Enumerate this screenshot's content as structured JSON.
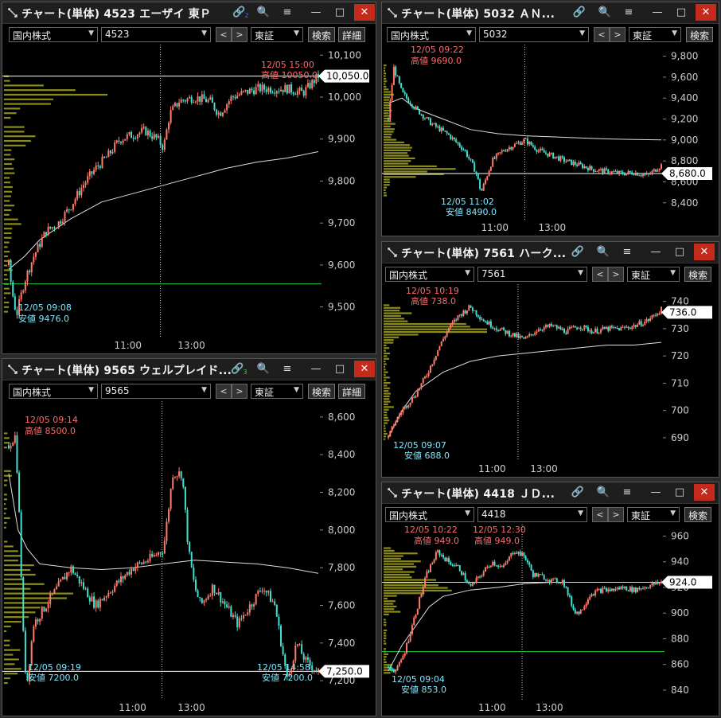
{
  "market_options": "国内株式",
  "exchange": "東証",
  "search_label": "検索",
  "detail_label": "詳細",
  "colors": {
    "up": "#ff7b6b",
    "down": "#40e0d0",
    "vwap": "#dddddd",
    "volume": "#8b8b1a",
    "support": "#22cc44",
    "high": "#ff6a6a",
    "low": "#7fe6ff"
  },
  "windows": [
    {
      "id": "w1",
      "title": "チャート(単体) 4523 エーザイ 東Ｐ",
      "code": "4523",
      "link_badge": "2",
      "has_detail": true,
      "high_time": "12/05 15:00",
      "high_label": "高値 10050.0",
      "low_time": "12/05 09:08",
      "low_label": "安値 9476.0",
      "current_price": "10,050.0",
      "x_ticks": [
        "11:00",
        "13:00"
      ],
      "y_ticks": [
        "10,100",
        "10,000",
        "9,900",
        "9,800",
        "9,700",
        "9,600",
        "9,500"
      ]
    },
    {
      "id": "w2",
      "title": "チャート(単体) 5032 ＡＮ...",
      "code": "5032",
      "link_badge": "",
      "has_detail": false,
      "high_time": "12/05 09:22",
      "high_label": "高値 9690.0",
      "low_time": "12/05 11:02",
      "low_label": "安値 8490.0",
      "current_price": "8,680.0",
      "x_ticks": [
        "11:00",
        "13:00"
      ],
      "y_ticks": [
        "9,800",
        "9,600",
        "9,400",
        "9,200",
        "9,000",
        "8,800",
        "8,600",
        "8,400"
      ]
    },
    {
      "id": "w3",
      "title": "チャート(単体) 9565 ウェルプレイド...",
      "code": "9565",
      "link_badge": "3",
      "has_detail": true,
      "high_time": "12/05 09:14",
      "high_label": "高値 8500.0",
      "low_time": "12/05 09:19",
      "low_label": "安値 7200.0",
      "low2_time": "12/05 14:58",
      "low2_label": "安値 7200.0",
      "current_price": "7,250.0",
      "x_ticks": [
        "11:00",
        "13:00"
      ],
      "y_ticks": [
        "8,600",
        "8,400",
        "8,200",
        "8,000",
        "7,800",
        "7,600",
        "7,400",
        "7,200"
      ]
    },
    {
      "id": "w4",
      "title": "チャート(単体) 7561 ハーク...",
      "code": "7561",
      "link_badge": "",
      "has_detail": false,
      "high_time": "12/05 10:19",
      "high_label": "高値 738.0",
      "low_time": "12/05 09:07",
      "low_label": "安値 688.0",
      "current_price": "736.0",
      "x_ticks": [
        "11:00",
        "13:00"
      ],
      "y_ticks": [
        "740",
        "730",
        "720",
        "710",
        "700",
        "690"
      ]
    },
    {
      "id": "w5",
      "title": "チャート(単体) 4418 ＪＤ...",
      "code": "4418",
      "link_badge": "",
      "has_detail": false,
      "high_time": "12/05 10:22",
      "high_label": "高値 949.0",
      "high2_time": "12/05 12:30",
      "high2_label": "高値 949.0",
      "low_time": "12/05 09:04",
      "low_label": "安値 853.0",
      "current_price": "924.0",
      "x_ticks": [
        "11:00",
        "13:00"
      ],
      "y_ticks": [
        "960",
        "940",
        "920",
        "900",
        "880",
        "860",
        "840"
      ]
    }
  ],
  "chart_data": [
    {
      "type": "candlestick",
      "title": "4523",
      "ylim": [
        9450,
        10110
      ],
      "path": [
        [
          0,
          9600
        ],
        [
          0.01,
          9540
        ],
        [
          0.025,
          9480
        ],
        [
          0.05,
          9560
        ],
        [
          0.08,
          9620
        ],
        [
          0.12,
          9680
        ],
        [
          0.16,
          9700
        ],
        [
          0.2,
          9740
        ],
        [
          0.24,
          9790
        ],
        [
          0.28,
          9830
        ],
        [
          0.32,
          9860
        ],
        [
          0.36,
          9900
        ],
        [
          0.4,
          9910
        ],
        [
          0.44,
          9920
        ],
        [
          0.48,
          9900
        ],
        [
          0.5,
          9880
        ],
        [
          0.52,
          9960
        ],
        [
          0.55,
          9990
        ],
        [
          0.6,
          10000
        ],
        [
          0.65,
          9990
        ],
        [
          0.68,
          9960
        ],
        [
          0.72,
          10000
        ],
        [
          0.76,
          10010
        ],
        [
          0.8,
          10020
        ],
        [
          0.85,
          10020
        ],
        [
          0.9,
          10020
        ],
        [
          0.95,
          10010
        ],
        [
          1,
          10050
        ]
      ],
      "vwap": [
        [
          0,
          9590
        ],
        [
          0.05,
          9620
        ],
        [
          0.1,
          9660
        ],
        [
          0.2,
          9710
        ],
        [
          0.3,
          9750
        ],
        [
          0.4,
          9770
        ],
        [
          0.5,
          9790
        ],
        [
          0.6,
          9810
        ],
        [
          0.7,
          9830
        ],
        [
          0.8,
          9845
        ],
        [
          0.9,
          9855
        ],
        [
          1,
          9870
        ]
      ],
      "hlines": [
        {
          "y": 10050,
          "color": "#ffffff"
        },
        {
          "y": 9555,
          "color": "#22cc44"
        }
      ],
      "x_ticks": [
        {
          "label": "11:00",
          "x": 0.385
        },
        {
          "label": "13:00",
          "x": 0.59
        }
      ],
      "break_x": 0.49,
      "y_ticks": [
        10100,
        10000,
        9900,
        9800,
        9700,
        9600,
        9500
      ],
      "current": 10050,
      "vol_profile_top": 9860,
      "vol_profile_bottom": 9990
    },
    {
      "type": "candlestick",
      "title": "5032",
      "ylim": [
        8330,
        9850
      ],
      "path": [
        [
          0,
          9200
        ],
        [
          0.02,
          9690
        ],
        [
          0.05,
          9450
        ],
        [
          0.1,
          9300
        ],
        [
          0.16,
          9150
        ],
        [
          0.22,
          9050
        ],
        [
          0.28,
          8900
        ],
        [
          0.32,
          8700
        ],
        [
          0.34,
          8500
        ],
        [
          0.38,
          8800
        ],
        [
          0.42,
          8900
        ],
        [
          0.46,
          8950
        ],
        [
          0.5,
          9000
        ],
        [
          0.55,
          8900
        ],
        [
          0.6,
          8850
        ],
        [
          0.65,
          8800
        ],
        [
          0.7,
          8760
        ],
        [
          0.75,
          8720
        ],
        [
          0.8,
          8700
        ],
        [
          0.85,
          8680
        ],
        [
          0.9,
          8690
        ],
        [
          0.95,
          8660
        ],
        [
          1,
          8760
        ]
      ],
      "vwap": [
        [
          0,
          9350
        ],
        [
          0.05,
          9400
        ],
        [
          0.1,
          9300
        ],
        [
          0.2,
          9200
        ],
        [
          0.3,
          9100
        ],
        [
          0.4,
          9060
        ],
        [
          0.5,
          9040
        ],
        [
          0.6,
          9030
        ],
        [
          0.7,
          9020
        ],
        [
          0.8,
          9010
        ],
        [
          0.9,
          9005
        ],
        [
          1,
          9000
        ]
      ],
      "hlines": [
        {
          "y": 8680,
          "color": "#ffffff"
        }
      ],
      "x_ticks": [
        {
          "label": "11:00",
          "x": 0.39
        },
        {
          "label": "13:00",
          "x": 0.6
        }
      ],
      "break_x": 0.5,
      "y_ticks": [
        9800,
        9600,
        9400,
        9200,
        9000,
        8800,
        8600,
        8400
      ],
      "current": 8680
    },
    {
      "type": "candlestick",
      "title": "9565",
      "ylim": [
        7150,
        8650
      ],
      "path": [
        [
          0,
          8450
        ],
        [
          0.02,
          8500
        ],
        [
          0.03,
          8250
        ],
        [
          0.05,
          7300
        ],
        [
          0.06,
          7200
        ],
        [
          0.08,
          7500
        ],
        [
          0.12,
          7600
        ],
        [
          0.16,
          7700
        ],
        [
          0.2,
          7800
        ],
        [
          0.24,
          7700
        ],
        [
          0.28,
          7600
        ],
        [
          0.34,
          7700
        ],
        [
          0.4,
          7800
        ],
        [
          0.46,
          7850
        ],
        [
          0.5,
          7900
        ],
        [
          0.53,
          8300
        ],
        [
          0.56,
          8300
        ],
        [
          0.58,
          7900
        ],
        [
          0.6,
          7700
        ],
        [
          0.62,
          7600
        ],
        [
          0.66,
          7700
        ],
        [
          0.7,
          7600
        ],
        [
          0.74,
          7500
        ],
        [
          0.78,
          7600
        ],
        [
          0.82,
          7700
        ],
        [
          0.86,
          7600
        ],
        [
          0.88,
          7400
        ],
        [
          0.9,
          7200
        ],
        [
          0.93,
          7400
        ],
        [
          0.96,
          7300
        ],
        [
          1,
          7250
        ]
      ],
      "vwap": [
        [
          0,
          8300
        ],
        [
          0.03,
          8000
        ],
        [
          0.06,
          7900
        ],
        [
          0.1,
          7820
        ],
        [
          0.2,
          7800
        ],
        [
          0.3,
          7790
        ],
        [
          0.4,
          7800
        ],
        [
          0.5,
          7820
        ],
        [
          0.6,
          7840
        ],
        [
          0.7,
          7830
        ],
        [
          0.8,
          7820
        ],
        [
          0.9,
          7800
        ],
        [
          1,
          7770
        ]
      ],
      "hlines": [
        {
          "y": 7250,
          "color": "#ffffff"
        }
      ],
      "x_ticks": [
        {
          "label": "11:00",
          "x": 0.4
        },
        {
          "label": "13:00",
          "x": 0.59
        }
      ],
      "break_x": 0.495,
      "y_ticks": [
        8600,
        8400,
        8200,
        8000,
        7800,
        7600,
        7400,
        7200
      ],
      "current": 7250
    },
    {
      "type": "candlestick",
      "title": "7561",
      "ylim": [
        685,
        744
      ],
      "path": [
        [
          0,
          690
        ],
        [
          0.02,
          695
        ],
        [
          0.05,
          700
        ],
        [
          0.1,
          706
        ],
        [
          0.14,
          713
        ],
        [
          0.18,
          722
        ],
        [
          0.22,
          730
        ],
        [
          0.26,
          735
        ],
        [
          0.3,
          738
        ],
        [
          0.35,
          733
        ],
        [
          0.4,
          730
        ],
        [
          0.45,
          728
        ],
        [
          0.5,
          726
        ],
        [
          0.55,
          730
        ],
        [
          0.6,
          731
        ],
        [
          0.65,
          729
        ],
        [
          0.7,
          731
        ],
        [
          0.75,
          729
        ],
        [
          0.8,
          730
        ],
        [
          0.85,
          730
        ],
        [
          0.9,
          731
        ],
        [
          0.95,
          733
        ],
        [
          1,
          737
        ]
      ],
      "vwap": [
        [
          0,
          690
        ],
        [
          0.05,
          700
        ],
        [
          0.1,
          707
        ],
        [
          0.2,
          714
        ],
        [
          0.3,
          718
        ],
        [
          0.4,
          720
        ],
        [
          0.5,
          721
        ],
        [
          0.6,
          722
        ],
        [
          0.7,
          723
        ],
        [
          0.8,
          724
        ],
        [
          0.9,
          724
        ],
        [
          1,
          725
        ]
      ],
      "hlines": [],
      "x_ticks": [
        {
          "label": "11:00",
          "x": 0.38
        },
        {
          "label": "13:00",
          "x": 0.57
        }
      ],
      "break_x": 0.475,
      "y_ticks": [
        740,
        730,
        720,
        710,
        700,
        690
      ],
      "current": 736
    },
    {
      "type": "candlestick",
      "title": "4418",
      "ylim": [
        840,
        964
      ],
      "path": [
        [
          0,
          858
        ],
        [
          0.03,
          855
        ],
        [
          0.06,
          870
        ],
        [
          0.1,
          900
        ],
        [
          0.14,
          930
        ],
        [
          0.18,
          948
        ],
        [
          0.22,
          940
        ],
        [
          0.26,
          935
        ],
        [
          0.3,
          920
        ],
        [
          0.34,
          930
        ],
        [
          0.38,
          940
        ],
        [
          0.42,
          935
        ],
        [
          0.46,
          949
        ],
        [
          0.5,
          944
        ],
        [
          0.53,
          930
        ],
        [
          0.57,
          928
        ],
        [
          0.6,
          925
        ],
        [
          0.64,
          925
        ],
        [
          0.68,
          902
        ],
        [
          0.7,
          900
        ],
        [
          0.74,
          915
        ],
        [
          0.78,
          918
        ],
        [
          0.82,
          918
        ],
        [
          0.86,
          920
        ],
        [
          0.9,
          918
        ],
        [
          0.95,
          921
        ],
        [
          1,
          924
        ]
      ],
      "vwap": [
        [
          0,
          855
        ],
        [
          0.05,
          875
        ],
        [
          0.1,
          890
        ],
        [
          0.15,
          905
        ],
        [
          0.2,
          913
        ],
        [
          0.3,
          918
        ],
        [
          0.4,
          920
        ],
        [
          0.5,
          923
        ],
        [
          0.6,
          924
        ],
        [
          0.7,
          924
        ],
        [
          0.8,
          924
        ],
        [
          0.9,
          924
        ],
        [
          1,
          924
        ]
      ],
      "hlines": [
        {
          "y": 924,
          "color": "#dddddd"
        },
        {
          "y": 870,
          "color": "#22cc44"
        }
      ],
      "x_ticks": [
        {
          "label": "11:00",
          "x": 0.38
        },
        {
          "label": "13:00",
          "x": 0.59
        }
      ],
      "break_x": 0.49,
      "y_ticks": [
        960,
        940,
        920,
        900,
        880,
        860,
        840
      ],
      "current": 924
    }
  ]
}
